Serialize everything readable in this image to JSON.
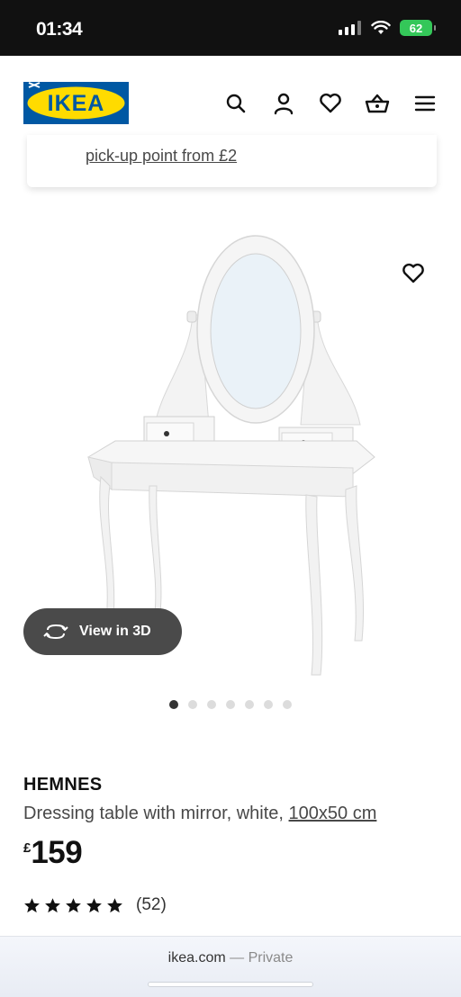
{
  "status_bar": {
    "time": "01:34",
    "battery": "62"
  },
  "header": {
    "logo_text": "IKEA",
    "icons": [
      "search-icon",
      "account-icon",
      "heart-icon",
      "basket-icon",
      "menu-icon"
    ]
  },
  "notice": {
    "link_text": "pick-up point from £2"
  },
  "gallery": {
    "view_3d_label": "View in 3D",
    "total_images": 7,
    "active_index": 0
  },
  "product": {
    "name": "HEMNES",
    "description": "Dressing table with mirror, white, ",
    "size": "100x50 cm",
    "currency": "£",
    "price": "159",
    "rating_stars": 5,
    "review_count": "(52)"
  },
  "browser": {
    "domain": "ikea.com",
    "separator": " — ",
    "mode": "Private"
  },
  "colors": {
    "ikea_blue": "#0058a3",
    "ikea_yellow": "#ffdb00",
    "battery_green": "#34c759"
  }
}
